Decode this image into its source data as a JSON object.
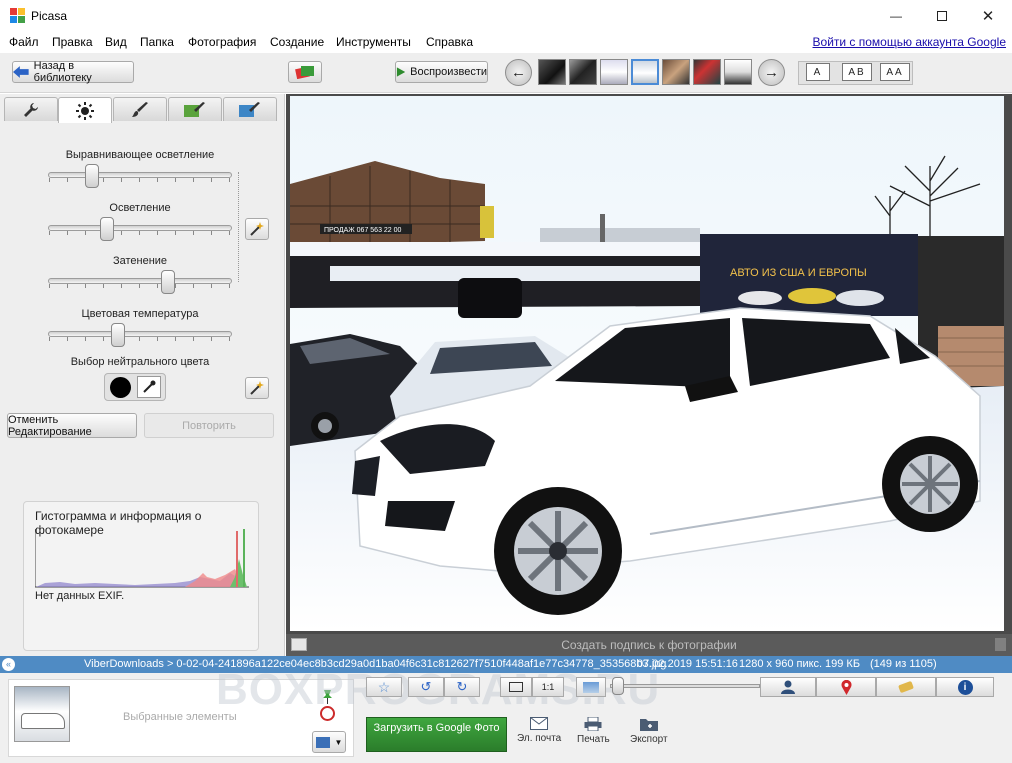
{
  "window": {
    "title": "Picasa",
    "minimize": "—",
    "maximize": "☐",
    "close": "✕"
  },
  "menu": [
    "Файл",
    "Правка",
    "Вид",
    "Папка",
    "Фотография",
    "Создание",
    "Инструменты",
    "Справка"
  ],
  "signin": "Войти с помощью аккаунта Google",
  "toolbar": {
    "back": "Назад в библиотеку",
    "play": "Воспроизвести",
    "captions": [
      "A",
      "AB",
      "AA"
    ]
  },
  "tabs": [
    "wrench-icon",
    "sun-icon",
    "brush-icon",
    "paint-brush-green-icon",
    "paint-brush-blue-icon"
  ],
  "tuning": {
    "fill_light_label": "Выравнивающее осветление",
    "highlights_label": "Осветление",
    "shadows_label": "Затенение",
    "color_temp_label": "Цветовая температура",
    "neutral_label": "Выбор нейтрального цвета",
    "fill_light": 0.24,
    "highlights": 0.32,
    "shadows": 0.65,
    "color_temp": 0.38
  },
  "buttons": {
    "undo": "Отменить Редактирование",
    "redo": "Повторить"
  },
  "histogram": {
    "title": "Гистограмма и информация о фотокамере",
    "exif": "Нет данных EXIF."
  },
  "photo": {
    "banner_text": "АВТО ИЗ США И ЕВРОПЫ",
    "sign_text": "ПРОДАЖ 067 563 22 00"
  },
  "caption_placeholder": "Создать подпись к фотографии",
  "status": {
    "path": "ViberDownloads > 0-02-04-241896a122ce04ec8b3cd29a0d1ba04f6c31c812627f7510f448af1e77c34778_353568b3.jpg",
    "date": "07.02.2019 15:51:16",
    "dims": "1280 x 960 пикс.",
    "size": "199 КБ",
    "count": "(149 из 1105)"
  },
  "bottom": {
    "selected_label": "Выбранные элементы",
    "upload": "Загрузить в Google Фото",
    "email": "Эл. почта",
    "print": "Печать",
    "export": "Экспорт",
    "one_to_one": "1:1",
    "watermark": "BOXPROGRAMS.RU"
  }
}
